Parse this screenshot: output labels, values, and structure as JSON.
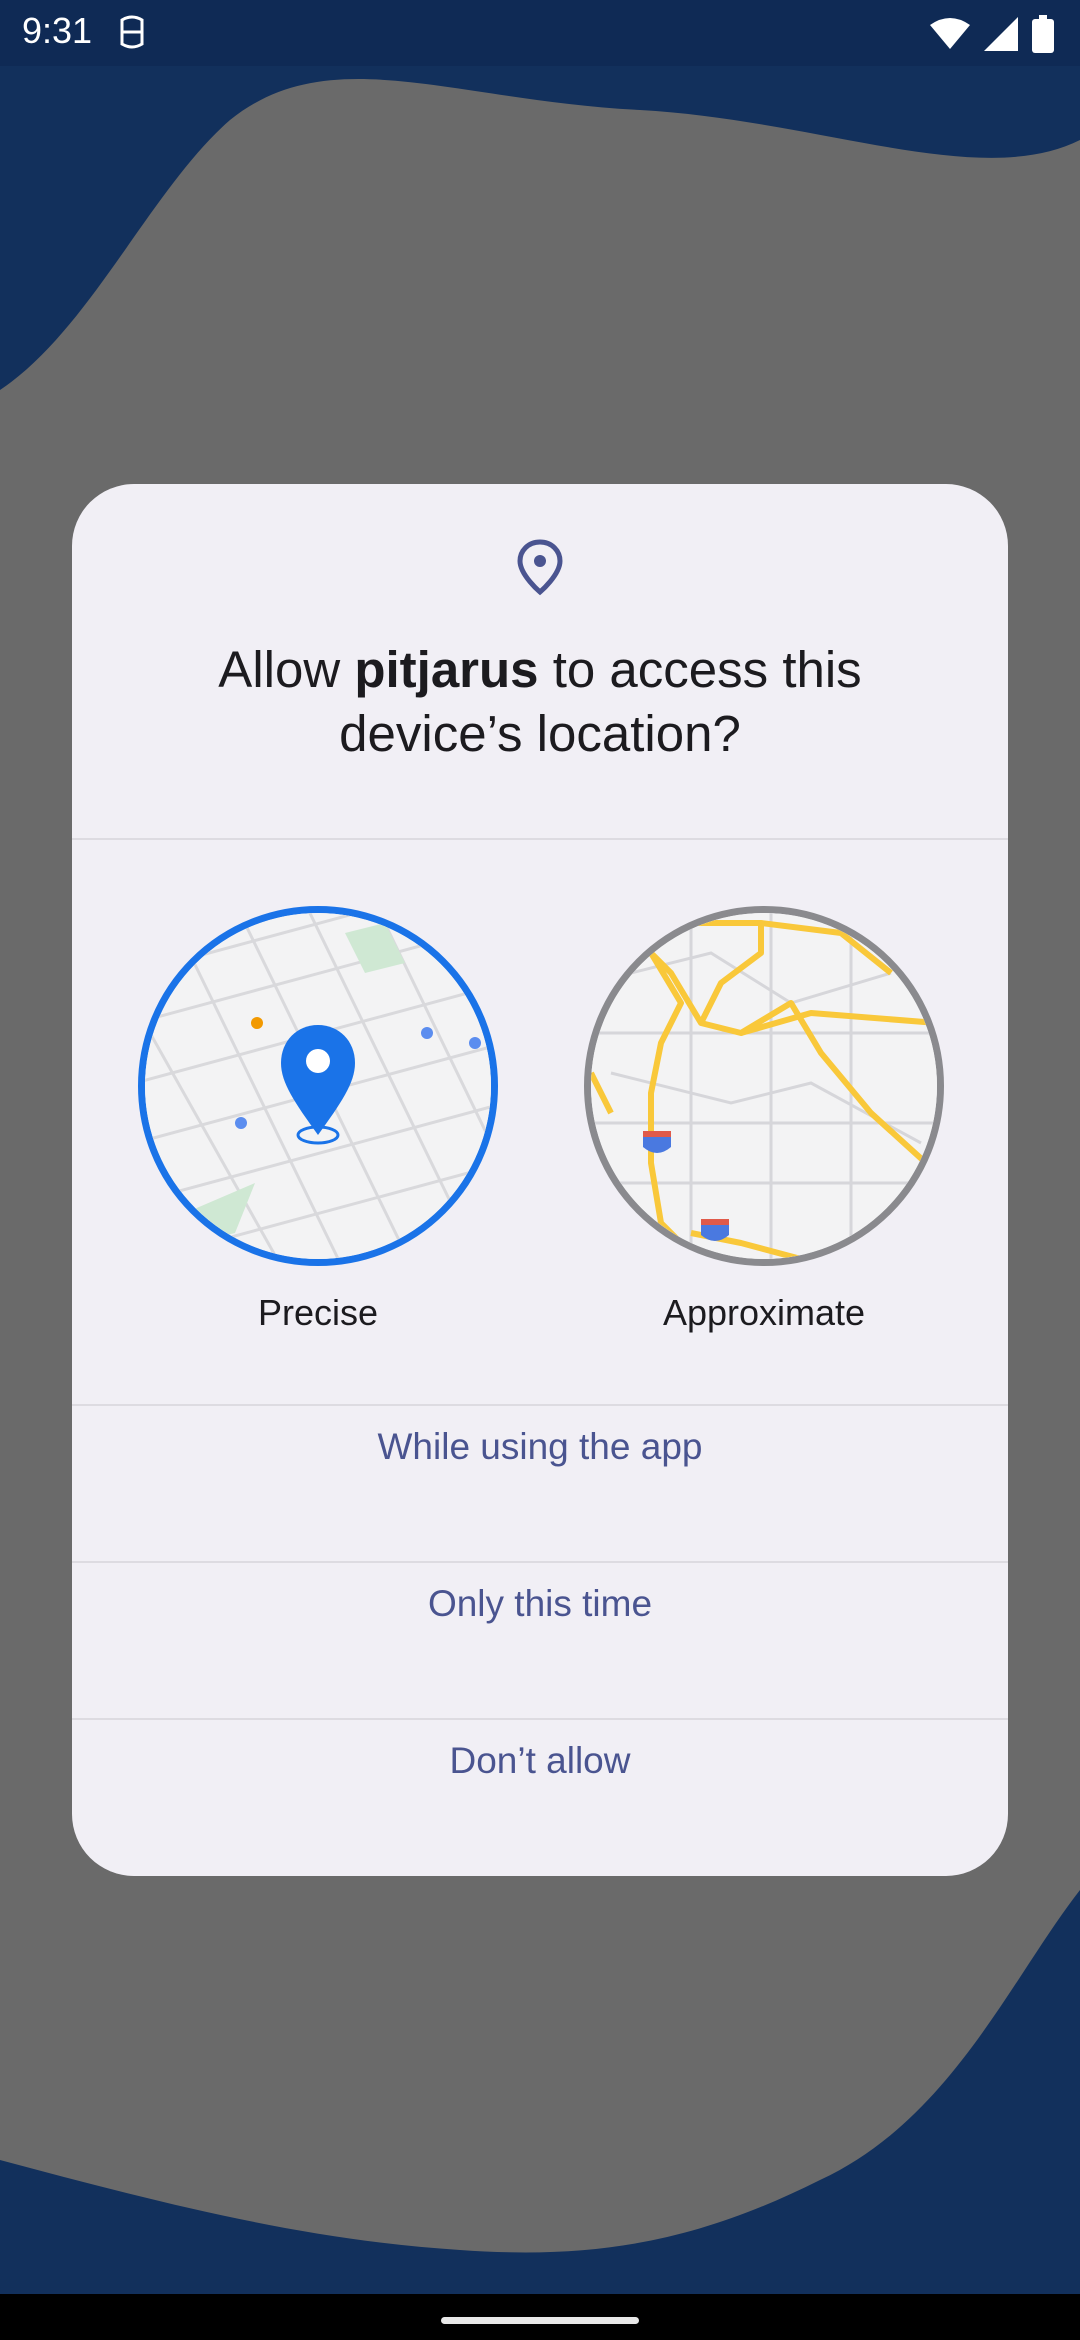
{
  "status_bar": {
    "time": "9:31",
    "left_icon": "debug-icon",
    "right_icons": [
      "wifi-icon",
      "signal-icon",
      "battery-icon"
    ]
  },
  "dialog": {
    "icon": "location-pin-icon",
    "title_prefix": "Allow ",
    "app_name": "pitjarus",
    "title_suffix": " to access this device’s location?",
    "options": {
      "precise_label": "Precise",
      "approximate_label": "Approximate"
    },
    "buttons": {
      "while_using": "While using the app",
      "only_this_time": "Only this time",
      "dont_allow": "Don’t allow"
    }
  },
  "colors": {
    "background_wave": "#12305c",
    "scrim": "#6a6a6a",
    "dialog_bg": "#f1eff5",
    "accent_blue": "#1a73e8",
    "button_text": "#4a5490",
    "map_road_yellow": "#f9c83a"
  }
}
